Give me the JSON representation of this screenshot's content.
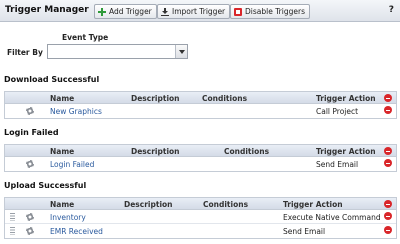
{
  "toolbar": {
    "title": "Trigger Manager",
    "add_label": "Add Trigger",
    "import_label": "Import Trigger",
    "disable_label": "Disable Triggers",
    "help_label": "?"
  },
  "filter": {
    "label": "Filter By",
    "event_type_label": "Event Type",
    "event_type_value": ""
  },
  "columns": {
    "name": "Name",
    "description": "Description",
    "conditions": "Conditions",
    "trigger_action": "Trigger Action"
  },
  "sections": [
    {
      "title": "Download Successful",
      "rows": [
        {
          "name": "New Graphics",
          "description": "",
          "conditions": "",
          "action": "Call Project"
        }
      ]
    },
    {
      "title": "Login Failed",
      "rows": [
        {
          "name": "Login Failed",
          "description": "",
          "conditions": "",
          "action": "Send Email"
        }
      ]
    },
    {
      "title": "Upload Successful",
      "rows": [
        {
          "name": "Inventory",
          "description": "",
          "conditions": "",
          "action": "Execute Native Command"
        },
        {
          "name": "EMR Received",
          "description": "",
          "conditions": "",
          "action": "Send Email"
        }
      ]
    }
  ],
  "colors": {
    "link": "#2a5a9e",
    "delete": "#d9262a",
    "header_bg": "#d4dbe7"
  }
}
